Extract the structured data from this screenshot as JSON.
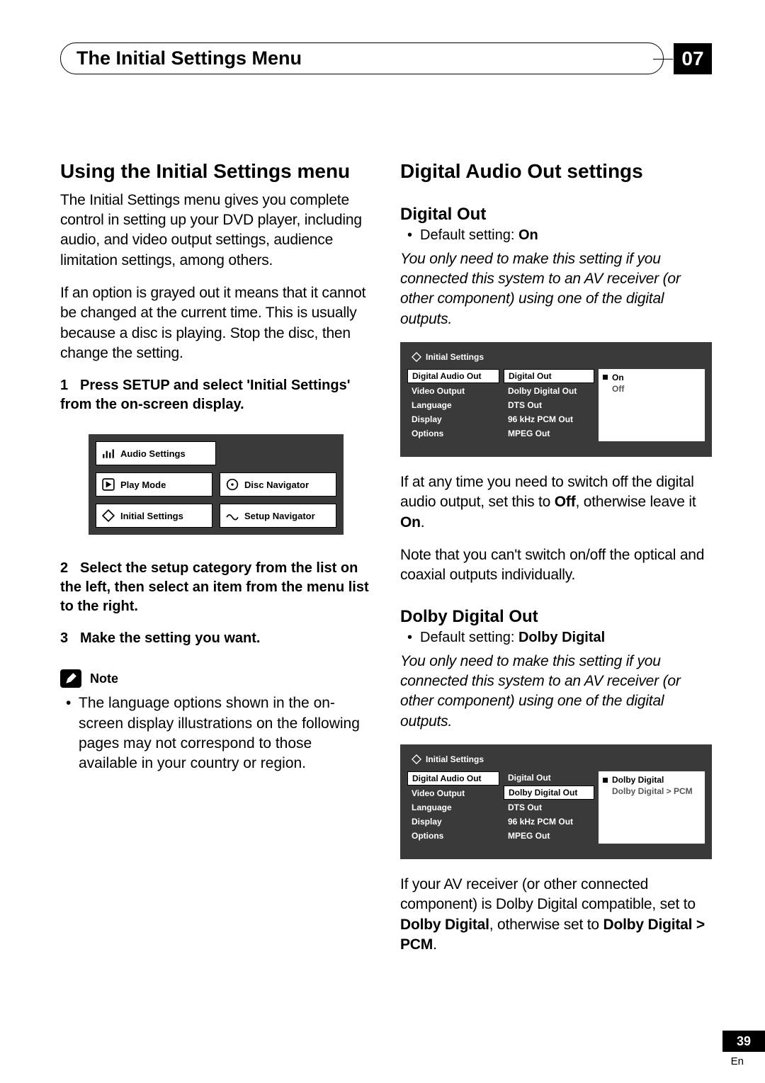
{
  "header": {
    "title": "The Initial Settings Menu",
    "chapter": "07"
  },
  "left": {
    "h1": "Using the Initial Settings menu",
    "p1": "The Initial Settings menu gives you complete control in setting up your DVD player, including audio, and video output settings, audience limitation settings, among others.",
    "p2": "If an option is grayed out it means that it cannot be changed at the current time. This is usually because a disc is playing. Stop the disc, then change the setting.",
    "step1_num": "1",
    "step1": "Press SETUP and select 'Initial Settings' from the on-screen display.",
    "menuGrid": {
      "audio": "Audio Settings",
      "playMode": "Play Mode",
      "discNav": "Disc Navigator",
      "initial": "Initial Settings",
      "setupNav": "Setup Navigator"
    },
    "step2_num": "2",
    "step2": "Select the setup category from the list on the left, then select an item from the menu list to the right.",
    "step3_num": "3",
    "step3": "Make the setting you want.",
    "noteLabel": "Note",
    "noteBullet": "The language options shown in the on-screen display illustrations on the following pages may not correspond to those available in your country or region."
  },
  "right": {
    "h1": "Digital Audio Out settings",
    "sub1": "Digital Out",
    "def1_prefix": "Default setting: ",
    "def1_bold": "On",
    "italic1": "You only need to make this setting if you connected this system to an AV receiver (or other component) using one of the digital outputs.",
    "osd1": {
      "title": "Initial Settings",
      "col1": [
        "Digital Audio Out",
        "Video Output",
        "Language",
        "Display",
        "Options"
      ],
      "col1_selected": 0,
      "col2": [
        "Digital Out",
        "Dolby Digital Out",
        "DTS Out",
        "96 kHz PCM Out",
        "MPEG Out"
      ],
      "col2_selected": 0,
      "col3": [
        "On",
        "Off"
      ],
      "col3_selected": 0
    },
    "para1a": "If at any time you need to switch off the digital audio output, set this to ",
    "para1b": "Off",
    "para1c": ", otherwise leave it ",
    "para1d": "On",
    "para1e": ".",
    "para2": "Note that you can't switch on/off the optical and coaxial outputs individually.",
    "sub2": "Dolby Digital Out",
    "def2_prefix": "Default setting: ",
    "def2_bold": "Dolby Digital",
    "italic2": "You only need to make this setting if you connected this system to an AV receiver (or other component) using one of the digital outputs.",
    "osd2": {
      "title": "Initial Settings",
      "col1": [
        "Digital Audio Out",
        "Video Output",
        "Language",
        "Display",
        "Options"
      ],
      "col1_selected": 0,
      "col2": [
        "Digital Out",
        "Dolby Digital Out",
        "DTS Out",
        "96 kHz PCM Out",
        "MPEG Out"
      ],
      "col2_selected": 1,
      "col3": [
        "Dolby Digital",
        "Dolby Digital > PCM"
      ],
      "col3_selected": 0
    },
    "para3a": "If your AV receiver (or other connected component) is Dolby Digital compatible, set to ",
    "para3b": "Dolby Digital",
    "para3c": ", otherwise set to ",
    "para3d": "Dolby Digital > PCM",
    "para3e": "."
  },
  "footer": {
    "pageNum": "39",
    "lang": "En"
  }
}
